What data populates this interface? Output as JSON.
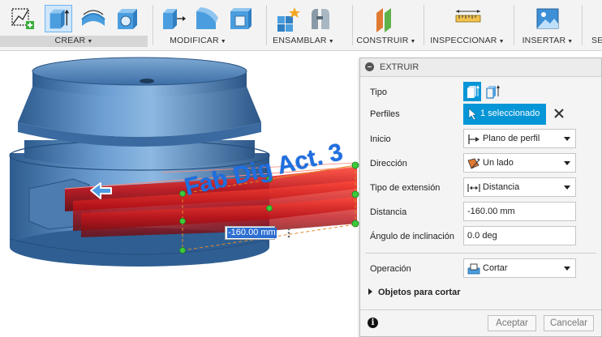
{
  "toolbar": {
    "groups": [
      {
        "label": "CREAR"
      },
      {
        "label": "MODIFICAR"
      },
      {
        "label": "ENSAMBLAR"
      },
      {
        "label": "CONSTRUIR"
      },
      {
        "label": "INSPECCIONAR"
      },
      {
        "label": "INSERTAR"
      },
      {
        "label": "SE"
      }
    ]
  },
  "viewport": {
    "overlay_text": "Fab Dig Act. 3",
    "distance_input_value": "-160.00 mm"
  },
  "dialog": {
    "title": "EXTRUIR",
    "rows": {
      "tipo": {
        "label": "Tipo"
      },
      "perfiles": {
        "label": "Perfiles",
        "value": "1 seleccionado"
      },
      "inicio": {
        "label": "Inicio",
        "value": "Plano de perfil"
      },
      "direccion": {
        "label": "Dirección",
        "value": "Un lado"
      },
      "tipo_extension": {
        "label": "Tipo de extensión",
        "value": "Distancia"
      },
      "distancia": {
        "label": "Distancia",
        "value": "-160.00 mm"
      },
      "angulo": {
        "label": "Ángulo de inclinación",
        "value": "0.0 deg"
      },
      "operacion": {
        "label": "Operación",
        "value": "Cortar"
      }
    },
    "objects_label": "Objetos para cortar",
    "ok_label": "Aceptar",
    "cancel_label": "Cancelar"
  },
  "colors": {
    "accent": "#0696d7",
    "model_blue": "#5b8fc4",
    "extrude_red": "#c0141a",
    "overlay_text": "#1f6fe0"
  },
  "icons": [
    "sketch-icon",
    "extrude-icon",
    "revolve-icon",
    "hole-icon",
    "press-pull-icon",
    "fillet-icon",
    "shell-icon",
    "new-component-icon",
    "joint-icon",
    "offset-plane-icon",
    "measure-icon",
    "insert-image-icon"
  ]
}
